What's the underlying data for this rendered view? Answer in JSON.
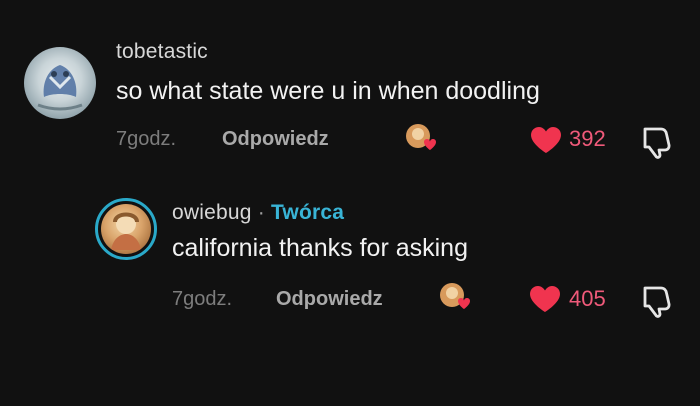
{
  "comments": [
    {
      "username": "tobetastic",
      "text": "so what state were u in when doodling",
      "time": "7godz.",
      "reply_label": "Odpowiedz",
      "likes": "392",
      "avatar": "profile-avatar-icon"
    },
    {
      "username": "owiebug",
      "separator": "·",
      "creator_badge": "Twórca",
      "text": "california thanks for asking",
      "time": "7godz.",
      "reply_label": "Odpowiedz",
      "likes": "405",
      "avatar": "profile-avatar-icon"
    }
  ],
  "colors": {
    "background": "#111111",
    "like_red": "#f0344f",
    "creator_blue": "#39b4d6"
  },
  "icons": {
    "like": "heart-icon",
    "dislike": "thumbs-down-icon",
    "creator_liked": "creator-liked-badge-icon"
  }
}
